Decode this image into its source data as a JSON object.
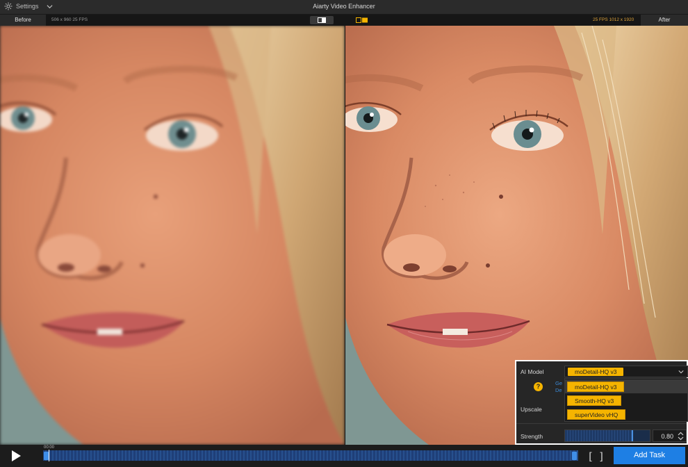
{
  "titlebar": {
    "settings_label": "Settings",
    "app_title": "Aiarty Video Enhancer"
  },
  "infobar": {
    "before_tab": "Before",
    "before_info": "506 x 960  25 FPS",
    "after_info": "25 FPS  1012 x 1920",
    "after_tab": "After"
  },
  "model_panel": {
    "ai_model_label": "AI Model",
    "selected_model": "moDetail-HQ  v3",
    "link_fragment_1": "Ge",
    "link_fragment_2": "De",
    "help_glyph": "?",
    "options": [
      "moDetail-HQ  v3",
      "Smooth-HQ  v3",
      "superVideo vHQ"
    ],
    "upscale_label": "Upscale",
    "strength_label": "Strength",
    "strength_value": "0.80",
    "strength_level": 0.8
  },
  "playback": {
    "timecode": "00:00",
    "bracket_in": "[",
    "bracket_out": "]",
    "add_task_label": "Add Task"
  },
  "colors": {
    "accent_yellow": "#f5b400",
    "primary_blue": "#1e7fe4",
    "timeline_blue": "#27508e"
  },
  "icons": {
    "settings": "gear-icon",
    "dropdown": "chevron-down-icon",
    "play": "play-icon",
    "help": "question-icon",
    "split": "split-view-icon",
    "spinner": "spinner-arrows-icon"
  }
}
